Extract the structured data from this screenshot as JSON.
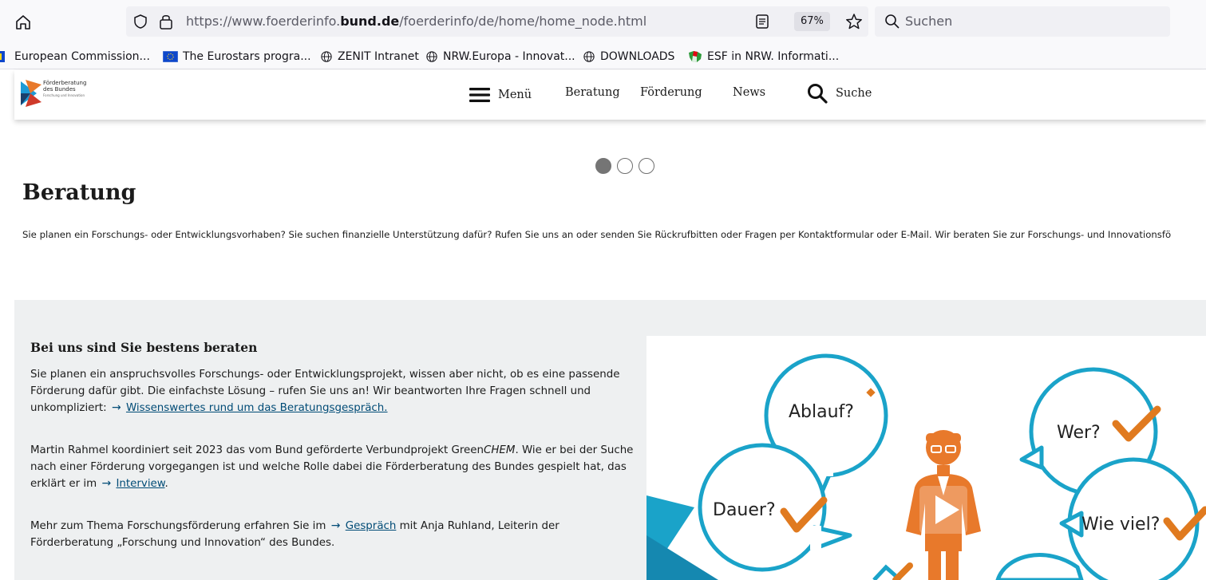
{
  "browser": {
    "url_prefix": "https://www.foerderinfo.",
    "url_domain": "bund.de",
    "url_path": "/foerderinfo/de/home/home_node.html",
    "zoom": "67%",
    "search_placeholder": "Suchen"
  },
  "bookmarks": [
    {
      "label": "European Commission...",
      "icon": "eu-icon"
    },
    {
      "label": "The Eurostars progra...",
      "icon": "eu-flag-icon"
    },
    {
      "label": "ZENIT Intranet",
      "icon": "globe-icon"
    },
    {
      "label": "NRW.Europa - Innovat...",
      "icon": "globe-icon"
    },
    {
      "label": "DOWNLOADS",
      "icon": "globe-icon"
    },
    {
      "label": "ESF in NRW. Informati...",
      "icon": "nrw-icon"
    }
  ],
  "site": {
    "logo_line1": "Förderberatung",
    "logo_line2": "des Bundes",
    "logo_line3": "Forschung und Innovation",
    "nav": {
      "menu": "Menü",
      "beratung": "Beratung",
      "foerderung": "Förderung",
      "news": "News",
      "suche": "Suche"
    }
  },
  "carousel": {
    "slides": 3,
    "active": 1
  },
  "intro": {
    "title": "Beratung",
    "text": "Sie planen ein Forschungs- oder Entwicklungsvorhaben? Sie suchen finanzielle Unterstützung dafür? Rufen Sie uns an oder senden Sie Rückrufbitten oder Fragen per Kontaktformular oder E-Mail. Wir beraten Sie zur Forschungs- und Innovationsfö"
  },
  "section": {
    "title": "Bei uns sind Sie bestens beraten",
    "p1_text": "Sie planen ein anspruchsvolles Forschungs- oder Entwicklungsprojekt, wissen aber nicht, ob es eine passende Förderung dafür gibt. Die einfachste Lösung – rufen Sie uns an! Wir beantworten Ihre Fragen schnell und unkompliziert:",
    "p1_link": "Wissenswertes rund um das Beratungsgespräch.",
    "p2_text_a": "Martin Rahmel koordiniert seit 2023 das vom Bund geförderte Verbundprojekt Green",
    "p2_text_em": "CHEM",
    "p2_text_b": ". Wie er bei der Suche nach einer Förderung vorgegangen ist und welche Rolle dabei die Förderberatung des Bundes gespielt hat, das erklärt er im",
    "p2_link": "Interview",
    "p2_end": ".",
    "p3_text_a": "Mehr zum Thema Forschungsförderung erfahren Sie im",
    "p3_link": "Gespräch",
    "p3_text_b": "mit Anja Ruhland, Leiterin der Förderberatung „Forschung und Innovation“ des Bundes.",
    "video_bubbles": [
      "Ablauf?",
      "Wer?",
      "Dauer?",
      "Wie viel?"
    ]
  },
  "colors": {
    "link": "#004b76",
    "grey_bg": "#eef0f1",
    "bubble_blue": "#1aa3c9",
    "check_orange": "#e07a1f",
    "figure_orange": "#e8792b"
  }
}
